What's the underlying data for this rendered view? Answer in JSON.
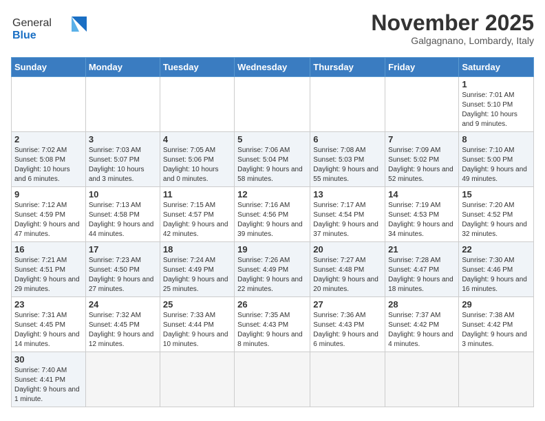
{
  "header": {
    "logo_general": "General",
    "logo_blue": "Blue",
    "month_title": "November 2025",
    "subtitle": "Galgagnano, Lombardy, Italy"
  },
  "weekdays": [
    "Sunday",
    "Monday",
    "Tuesday",
    "Wednesday",
    "Thursday",
    "Friday",
    "Saturday"
  ],
  "weeks": [
    [
      {
        "day": "",
        "info": ""
      },
      {
        "day": "",
        "info": ""
      },
      {
        "day": "",
        "info": ""
      },
      {
        "day": "",
        "info": ""
      },
      {
        "day": "",
        "info": ""
      },
      {
        "day": "",
        "info": ""
      },
      {
        "day": "1",
        "info": "Sunrise: 7:01 AM\nSunset: 5:10 PM\nDaylight: 10 hours and 9 minutes."
      }
    ],
    [
      {
        "day": "2",
        "info": "Sunrise: 7:02 AM\nSunset: 5:08 PM\nDaylight: 10 hours and 6 minutes."
      },
      {
        "day": "3",
        "info": "Sunrise: 7:03 AM\nSunset: 5:07 PM\nDaylight: 10 hours and 3 minutes."
      },
      {
        "day": "4",
        "info": "Sunrise: 7:05 AM\nSunset: 5:06 PM\nDaylight: 10 hours and 0 minutes."
      },
      {
        "day": "5",
        "info": "Sunrise: 7:06 AM\nSunset: 5:04 PM\nDaylight: 9 hours and 58 minutes."
      },
      {
        "day": "6",
        "info": "Sunrise: 7:08 AM\nSunset: 5:03 PM\nDaylight: 9 hours and 55 minutes."
      },
      {
        "day": "7",
        "info": "Sunrise: 7:09 AM\nSunset: 5:02 PM\nDaylight: 9 hours and 52 minutes."
      },
      {
        "day": "8",
        "info": "Sunrise: 7:10 AM\nSunset: 5:00 PM\nDaylight: 9 hours and 49 minutes."
      }
    ],
    [
      {
        "day": "9",
        "info": "Sunrise: 7:12 AM\nSunset: 4:59 PM\nDaylight: 9 hours and 47 minutes."
      },
      {
        "day": "10",
        "info": "Sunrise: 7:13 AM\nSunset: 4:58 PM\nDaylight: 9 hours and 44 minutes."
      },
      {
        "day": "11",
        "info": "Sunrise: 7:15 AM\nSunset: 4:57 PM\nDaylight: 9 hours and 42 minutes."
      },
      {
        "day": "12",
        "info": "Sunrise: 7:16 AM\nSunset: 4:56 PM\nDaylight: 9 hours and 39 minutes."
      },
      {
        "day": "13",
        "info": "Sunrise: 7:17 AM\nSunset: 4:54 PM\nDaylight: 9 hours and 37 minutes."
      },
      {
        "day": "14",
        "info": "Sunrise: 7:19 AM\nSunset: 4:53 PM\nDaylight: 9 hours and 34 minutes."
      },
      {
        "day": "15",
        "info": "Sunrise: 7:20 AM\nSunset: 4:52 PM\nDaylight: 9 hours and 32 minutes."
      }
    ],
    [
      {
        "day": "16",
        "info": "Sunrise: 7:21 AM\nSunset: 4:51 PM\nDaylight: 9 hours and 29 minutes."
      },
      {
        "day": "17",
        "info": "Sunrise: 7:23 AM\nSunset: 4:50 PM\nDaylight: 9 hours and 27 minutes."
      },
      {
        "day": "18",
        "info": "Sunrise: 7:24 AM\nSunset: 4:49 PM\nDaylight: 9 hours and 25 minutes."
      },
      {
        "day": "19",
        "info": "Sunrise: 7:26 AM\nSunset: 4:49 PM\nDaylight: 9 hours and 22 minutes."
      },
      {
        "day": "20",
        "info": "Sunrise: 7:27 AM\nSunset: 4:48 PM\nDaylight: 9 hours and 20 minutes."
      },
      {
        "day": "21",
        "info": "Sunrise: 7:28 AM\nSunset: 4:47 PM\nDaylight: 9 hours and 18 minutes."
      },
      {
        "day": "22",
        "info": "Sunrise: 7:30 AM\nSunset: 4:46 PM\nDaylight: 9 hours and 16 minutes."
      }
    ],
    [
      {
        "day": "23",
        "info": "Sunrise: 7:31 AM\nSunset: 4:45 PM\nDaylight: 9 hours and 14 minutes."
      },
      {
        "day": "24",
        "info": "Sunrise: 7:32 AM\nSunset: 4:45 PM\nDaylight: 9 hours and 12 minutes."
      },
      {
        "day": "25",
        "info": "Sunrise: 7:33 AM\nSunset: 4:44 PM\nDaylight: 9 hours and 10 minutes."
      },
      {
        "day": "26",
        "info": "Sunrise: 7:35 AM\nSunset: 4:43 PM\nDaylight: 9 hours and 8 minutes."
      },
      {
        "day": "27",
        "info": "Sunrise: 7:36 AM\nSunset: 4:43 PM\nDaylight: 9 hours and 6 minutes."
      },
      {
        "day": "28",
        "info": "Sunrise: 7:37 AM\nSunset: 4:42 PM\nDaylight: 9 hours and 4 minutes."
      },
      {
        "day": "29",
        "info": "Sunrise: 7:38 AM\nSunset: 4:42 PM\nDaylight: 9 hours and 3 minutes."
      }
    ],
    [
      {
        "day": "30",
        "info": "Sunrise: 7:40 AM\nSunset: 4:41 PM\nDaylight: 9 hours and 1 minute."
      },
      {
        "day": "",
        "info": ""
      },
      {
        "day": "",
        "info": ""
      },
      {
        "day": "",
        "info": ""
      },
      {
        "day": "",
        "info": ""
      },
      {
        "day": "",
        "info": ""
      },
      {
        "day": "",
        "info": ""
      }
    ]
  ]
}
